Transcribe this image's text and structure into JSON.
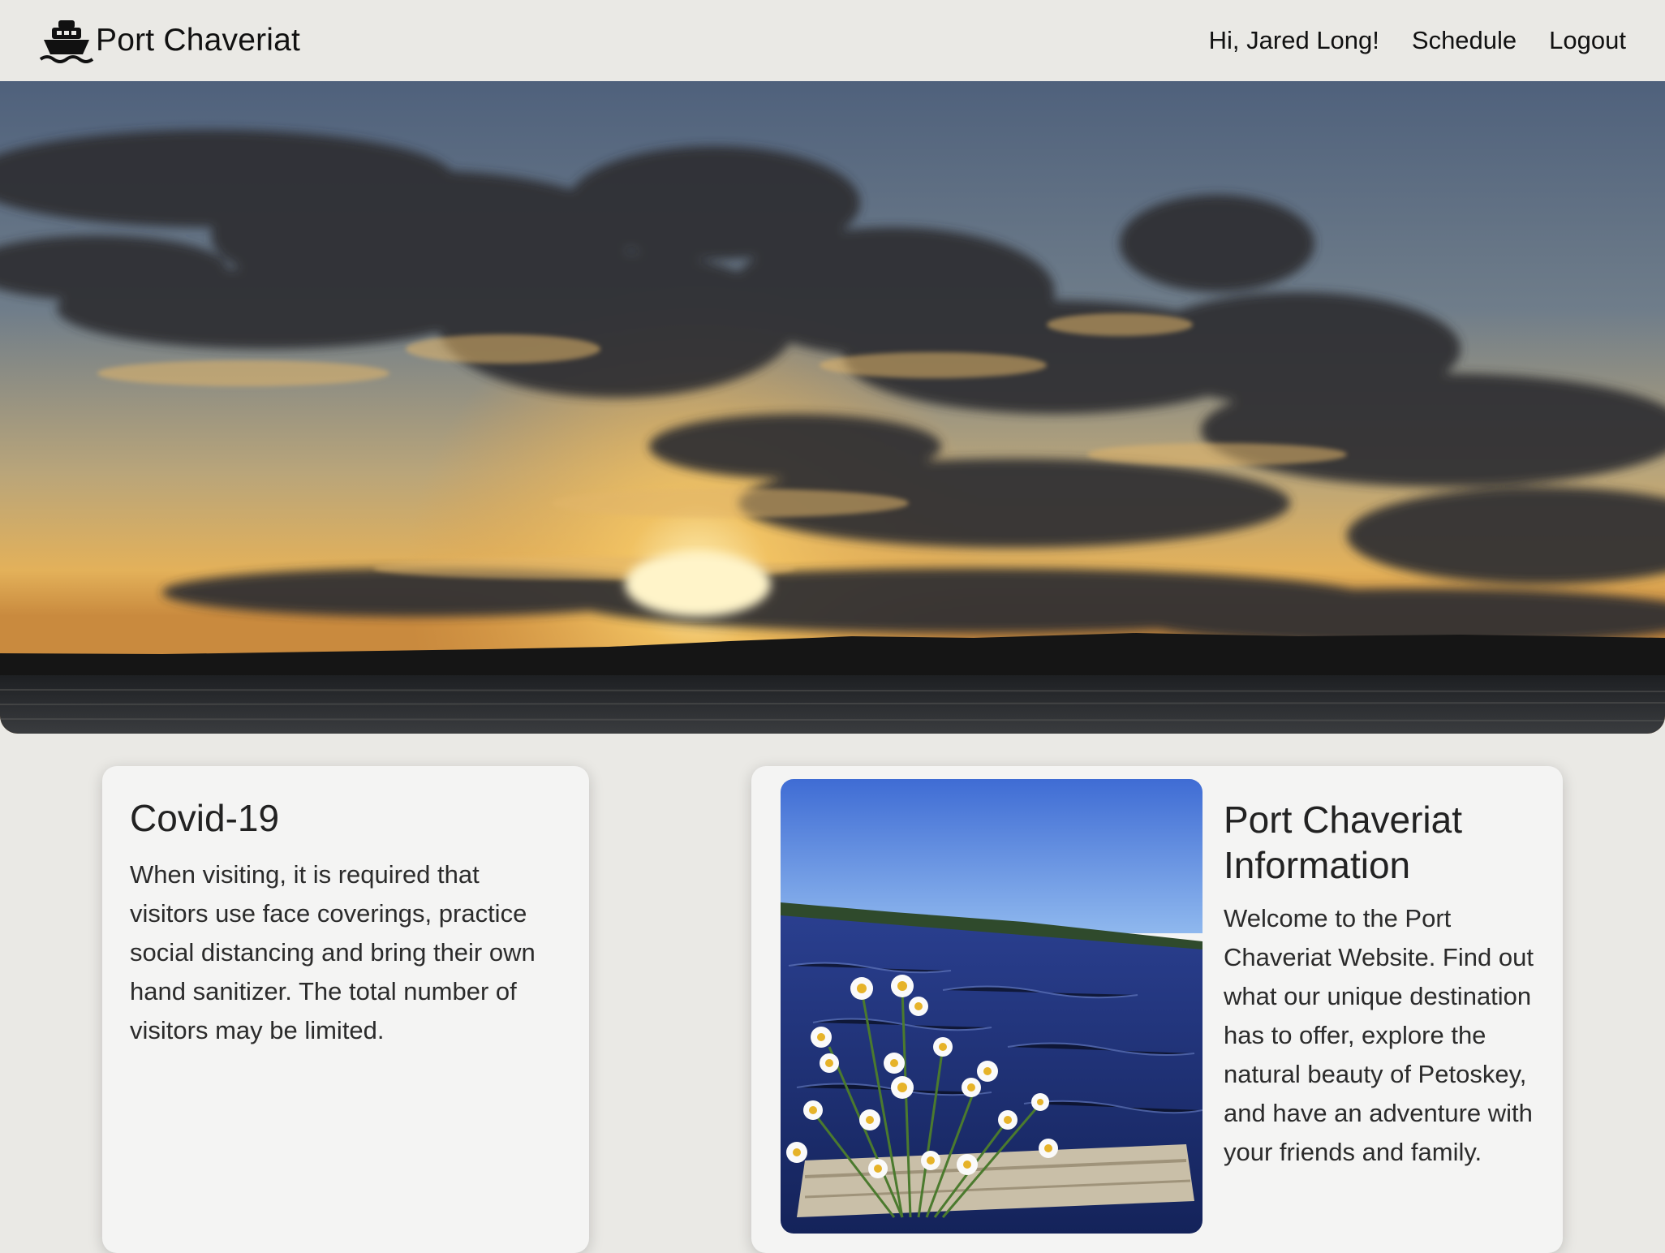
{
  "navbar": {
    "brand_name": "Port Chaveriat",
    "brand_icon": "ship-icon",
    "greeting": "Hi, Jared Long!",
    "schedule_label": "Schedule",
    "logout_label": "Logout"
  },
  "hero": {
    "image": "sunset-over-lake-photo"
  },
  "covid_card": {
    "title": "Covid-19",
    "text": "When visiting, it is required that visitors use face coverings, practice social distancing and bring their own hand sanitizer. The total number of visitors may be limited."
  },
  "info_card": {
    "image": "daisies-by-lake-photo",
    "title": "Port Chaveriat Information",
    "text": "Welcome to the Port Chaveriat Website. Find out what our unique destination has to offer, explore the natural beauty of Petoskey, and have an adventure with your friends and family."
  },
  "colors": {
    "page_background": "#eae9e5",
    "card_background": "#f4f4f3",
    "text": "#1f1f1f"
  }
}
